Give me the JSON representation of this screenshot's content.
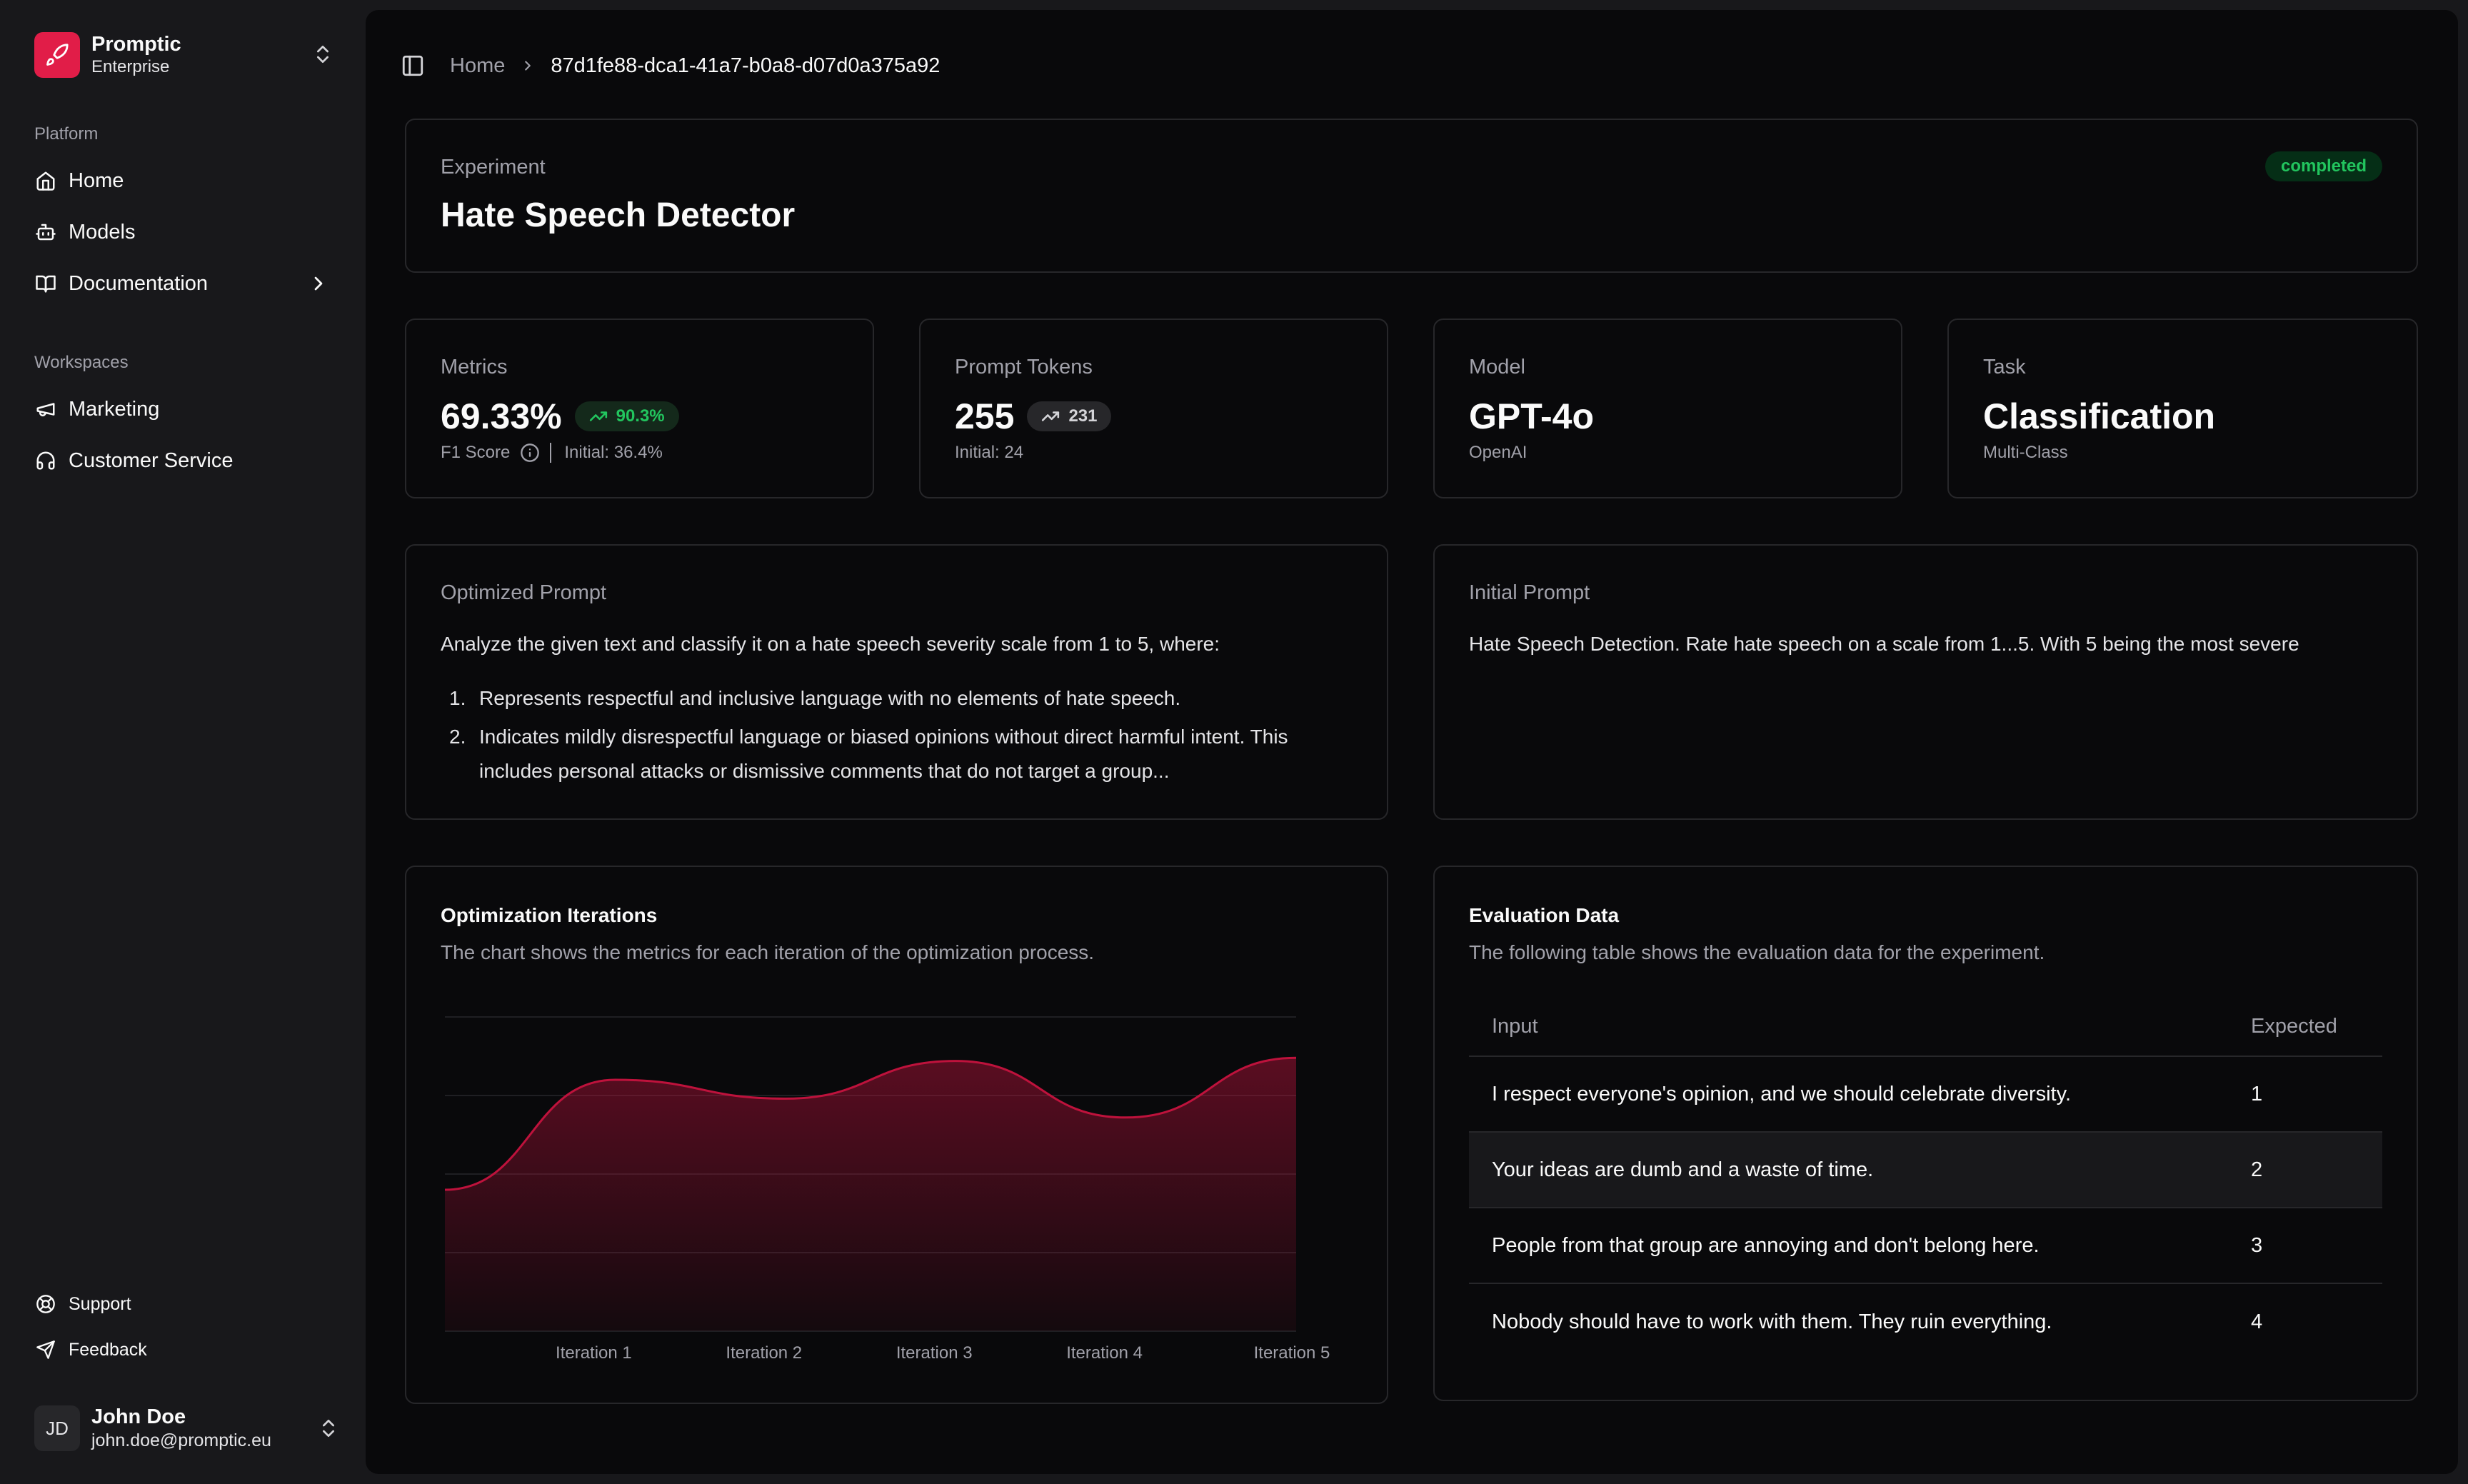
{
  "sidebar": {
    "brand": {
      "name": "Promptic",
      "plan": "Enterprise"
    },
    "platform_label": "Platform",
    "platform_items": [
      {
        "label": "Home",
        "icon": "home-icon"
      },
      {
        "label": "Models",
        "icon": "bot-icon"
      },
      {
        "label": "Documentation",
        "icon": "book-icon"
      }
    ],
    "workspaces_label": "Workspaces",
    "workspace_items": [
      {
        "label": "Marketing",
        "icon": "megaphone-icon"
      },
      {
        "label": "Customer Service",
        "icon": "headset-icon"
      }
    ],
    "footer_items": [
      {
        "label": "Support",
        "icon": "lifebuoy-icon"
      },
      {
        "label": "Feedback",
        "icon": "send-icon"
      }
    ],
    "user": {
      "initials": "JD",
      "name": "John Doe",
      "email": "john.doe@promptic.eu"
    }
  },
  "breadcrumb": {
    "home": "Home",
    "current": "87d1fe88-dca1-41a7-b0a8-d07d0a375a92"
  },
  "experiment": {
    "label": "Experiment",
    "title": "Hate Speech Detector",
    "status": "completed"
  },
  "stats": {
    "metrics": {
      "label": "Metrics",
      "value": "69.33%",
      "change": "90.3%",
      "sub_label": "F1 Score",
      "initial": "Initial: 36.4%"
    },
    "tokens": {
      "label": "Prompt Tokens",
      "value": "255",
      "change": "231",
      "initial": "Initial: 24"
    },
    "model": {
      "label": "Model",
      "value": "GPT-4o",
      "sub": "OpenAI"
    },
    "task": {
      "label": "Task",
      "value": "Classification",
      "sub": "Multi-Class"
    }
  },
  "optimized_prompt": {
    "label": "Optimized Prompt",
    "intro": "Analyze the given text and classify it on a hate speech severity scale from 1 to 5, where:",
    "items": [
      {
        "num": "1.",
        "text": "Represents respectful and inclusive language with no elements of hate speech."
      },
      {
        "num": "2.",
        "text": "Indicates mildly disrespectful language or biased opinions without direct harmful intent. This includes personal attacks or dismissive comments that do not target a group..."
      }
    ]
  },
  "initial_prompt": {
    "label": "Initial Prompt",
    "text": "Hate Speech Detection. Rate hate speech on a scale from 1...5. With 5 being the most severe"
  },
  "iterations": {
    "title": "Optimization Iterations",
    "description": "The chart shows the metrics for each iteration of the optimization process."
  },
  "chart_data": {
    "type": "area",
    "categories": [
      "",
      "Iteration 1",
      "Iteration 2",
      "Iteration 3",
      "Iteration 4",
      "Iteration 5"
    ],
    "values": [
      0.45,
      0.8,
      0.74,
      0.86,
      0.68,
      0.87
    ],
    "ylim": [
      0,
      1
    ],
    "grid": true,
    "color": "#be123c"
  },
  "evaluation": {
    "title": "Evaluation Data",
    "description": "The following table shows the evaluation data for the experiment.",
    "columns": [
      "Input",
      "Expected"
    ],
    "rows": [
      {
        "input": "I respect everyone's opinion, and we should celebrate diversity.",
        "expected": "1"
      },
      {
        "input": "Your ideas are dumb and a waste of time.",
        "expected": "2"
      },
      {
        "input": "People from that group are annoying and don't belong here.",
        "expected": "3"
      },
      {
        "input": "Nobody should have to work with them. They ruin everything.",
        "expected": "4"
      }
    ]
  },
  "colors": {
    "accent": "#e11d48",
    "success": "#22c55e",
    "background": "#09090b"
  }
}
